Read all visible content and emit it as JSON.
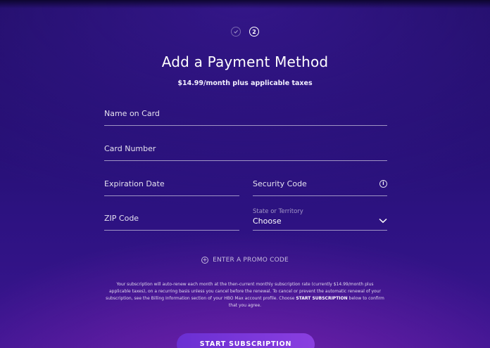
{
  "steps": {
    "current_number": "2"
  },
  "header": {
    "title": "Add a Payment Method",
    "subtitle": "$14.99/month plus applicable taxes"
  },
  "form": {
    "name_on_card": {
      "label": "Name on Card"
    },
    "card_number": {
      "label": "Card Number"
    },
    "expiration_date": {
      "label": "Expiration Date"
    },
    "security_code": {
      "label": "Security Code"
    },
    "zip_code": {
      "label": "ZIP Code"
    },
    "state": {
      "label": "State or Territory",
      "value": "Choose"
    }
  },
  "promo": {
    "label": "ENTER A PROMO CODE"
  },
  "legal": {
    "text_before": "Your subscription will auto-renew each month at the then-current monthly subscription rate (currently $14.99/month plus applicable taxes), on a recurring basis unless you cancel before the renewal. To cancel or prevent the automatic renewal of your subscription, see the Billing Information section of your HBO Max account profile. Choose ",
    "bold": "START SUBSCRIPTION",
    "text_after": " below to confirm that you agree."
  },
  "cta": {
    "label": "START SUBSCRIPTION"
  },
  "colors": {
    "background_top": "#1c0c5e",
    "background_bottom": "#3a1590",
    "button": "#7a36da"
  }
}
